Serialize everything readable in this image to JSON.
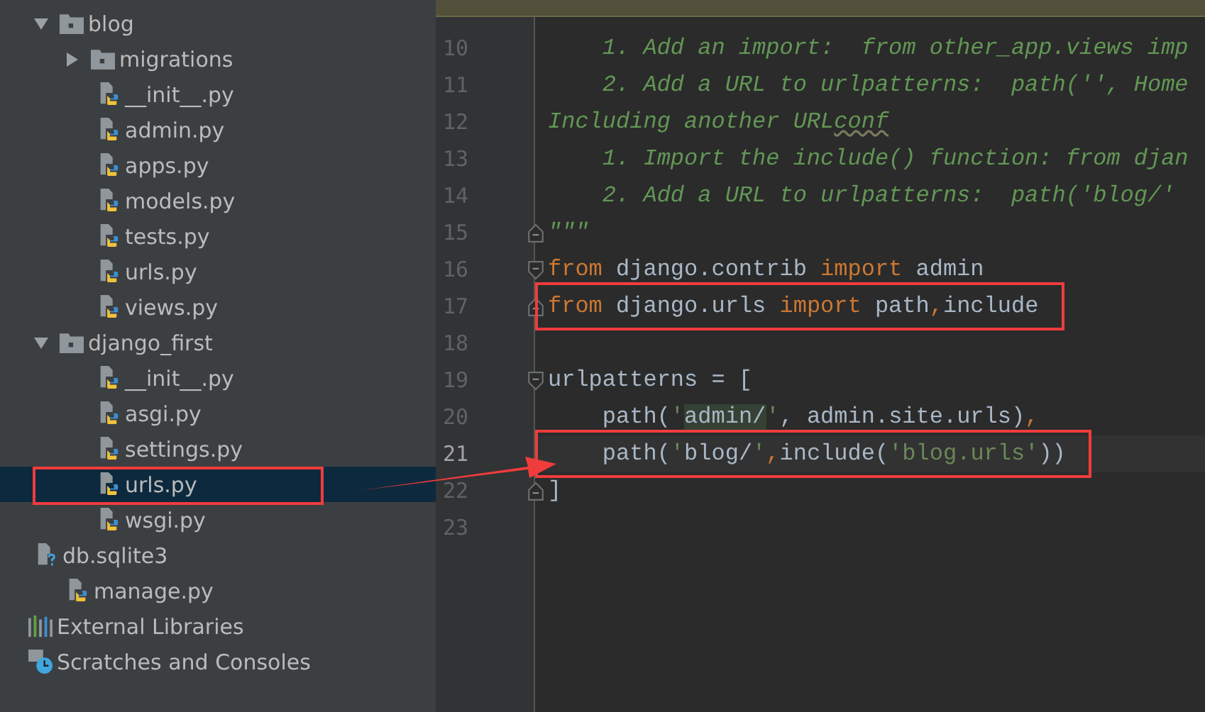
{
  "project_tree": [
    {
      "name": "blog",
      "kind": "folder",
      "expanded": true,
      "selected": false,
      "highlighted": false,
      "children": [
        {
          "name": "migrations",
          "kind": "folder",
          "expanded": false,
          "selected": false,
          "highlighted": false
        },
        {
          "name": "__init__.py",
          "kind": "python",
          "selected": false,
          "highlighted": false
        },
        {
          "name": "admin.py",
          "kind": "python",
          "selected": false,
          "highlighted": false
        },
        {
          "name": "apps.py",
          "kind": "python",
          "selected": false,
          "highlighted": false
        },
        {
          "name": "models.py",
          "kind": "python",
          "selected": false,
          "highlighted": false
        },
        {
          "name": "tests.py",
          "kind": "python",
          "selected": false,
          "highlighted": false
        },
        {
          "name": "urls.py",
          "kind": "python",
          "selected": false,
          "highlighted": false
        },
        {
          "name": "views.py",
          "kind": "python",
          "selected": false,
          "highlighted": false
        }
      ]
    },
    {
      "name": "django_first",
      "kind": "folder",
      "expanded": true,
      "selected": false,
      "highlighted": false,
      "children": [
        {
          "name": "__init__.py",
          "kind": "python",
          "selected": false,
          "highlighted": false
        },
        {
          "name": "asgi.py",
          "kind": "python",
          "selected": false,
          "highlighted": false
        },
        {
          "name": "settings.py",
          "kind": "python",
          "selected": false,
          "highlighted": false
        },
        {
          "name": "urls.py",
          "kind": "python",
          "selected": true,
          "highlighted": true
        },
        {
          "name": "wsgi.py",
          "kind": "python",
          "selected": false,
          "highlighted": false
        }
      ]
    },
    {
      "name": "db.sqlite3",
      "kind": "unknown",
      "selected": false,
      "highlighted": false
    },
    {
      "name": "manage.py",
      "kind": "python",
      "selected": false,
      "highlighted": false
    }
  ],
  "tree_footer": [
    {
      "name": "External Libraries",
      "kind": "libraries"
    },
    {
      "name": "Scratches and Consoles",
      "kind": "scratches"
    }
  ],
  "editor": {
    "lines": [
      {
        "number": "10",
        "current": false,
        "highlighted": false,
        "fold_start": false,
        "fold_end": false,
        "tokens": [
          {
            "text": "    1. Add an import:  from other_app.views imp",
            "kind": "doc"
          }
        ]
      },
      {
        "number": "11",
        "current": false,
        "highlighted": false,
        "fold_start": false,
        "fold_end": false,
        "tokens": [
          {
            "text": "    2. Add a URL to urlpatterns:  path('', Home",
            "kind": "doc"
          }
        ]
      },
      {
        "number": "12",
        "current": false,
        "highlighted": false,
        "fold_start": false,
        "fold_end": false,
        "tokens": [
          {
            "text": "Including another URL",
            "kind": "doc",
            "typo": false
          },
          {
            "text": "conf",
            "kind": "doc",
            "typo": true
          }
        ]
      },
      {
        "number": "13",
        "current": false,
        "highlighted": false,
        "fold_start": false,
        "fold_end": false,
        "tokens": [
          {
            "text": "    1. Import the include() function: from djan",
            "kind": "doc"
          }
        ]
      },
      {
        "number": "14",
        "current": false,
        "highlighted": false,
        "fold_start": false,
        "fold_end": false,
        "tokens": [
          {
            "text": "    2. Add a URL to urlpatterns:  path('blog/'",
            "kind": "doc"
          }
        ]
      },
      {
        "number": "15",
        "current": false,
        "highlighted": false,
        "fold_start": false,
        "fold_end": true,
        "tokens": [
          {
            "text": "\"\"\"",
            "kind": "doc"
          }
        ]
      },
      {
        "number": "16",
        "current": false,
        "highlighted": false,
        "fold_start": true,
        "fold_end": false,
        "tokens": [
          {
            "text": "from",
            "kind": "keyword"
          },
          {
            "text": " django.contrib ",
            "kind": "plain"
          },
          {
            "text": "import",
            "kind": "keyword"
          },
          {
            "text": " admin",
            "kind": "plain"
          }
        ]
      },
      {
        "number": "17",
        "current": false,
        "highlighted": true,
        "fold_start": false,
        "fold_end": true,
        "tokens": [
          {
            "text": "from",
            "kind": "keyword"
          },
          {
            "text": " django.urls ",
            "kind": "plain"
          },
          {
            "text": "import",
            "kind": "keyword"
          },
          {
            "text": " path",
            "kind": "plain"
          },
          {
            "text": ",",
            "kind": "keyword"
          },
          {
            "text": "include",
            "kind": "plain"
          }
        ]
      },
      {
        "number": "18",
        "current": false,
        "highlighted": false,
        "fold_start": false,
        "fold_end": false
      },
      {
        "number": "19",
        "current": false,
        "highlighted": false,
        "fold_start": true,
        "fold_end": false,
        "tokens": [
          {
            "text": "urlpatterns = [",
            "kind": "plain"
          }
        ]
      },
      {
        "number": "20",
        "current": false,
        "highlighted": false,
        "fold_start": false,
        "fold_end": false,
        "tokens": [
          {
            "text": "    path(",
            "kind": "plain"
          },
          {
            "text": "'",
            "kind": "string"
          },
          {
            "text": "admin/",
            "kind": "match"
          },
          {
            "text": "'",
            "kind": "string"
          },
          {
            "text": ", admin.site.urls)",
            "kind": "plain"
          },
          {
            "text": ",",
            "kind": "keyword"
          }
        ]
      },
      {
        "number": "21",
        "current": true,
        "highlighted": true,
        "fold_start": false,
        "fold_end": false,
        "tokens": [
          {
            "text": "    path(",
            "kind": "plain"
          },
          {
            "text": "'",
            "kind": "string"
          },
          {
            "text": "blog/",
            "kind": "plain"
          },
          {
            "text": "'",
            "kind": "string"
          },
          {
            "text": ",",
            "kind": "keyword"
          },
          {
            "text": "include(",
            "kind": "plain"
          },
          {
            "text": "'blog.urls'",
            "kind": "string"
          },
          {
            "text": "))",
            "kind": "plain"
          }
        ]
      },
      {
        "number": "22",
        "current": false,
        "highlighted": false,
        "fold_start": false,
        "fold_end": true,
        "tokens": [
          {
            "text": "]",
            "kind": "plain"
          }
        ]
      },
      {
        "number": "23",
        "current": false,
        "highlighted": false,
        "fold_start": false,
        "fold_end": false
      }
    ]
  }
}
